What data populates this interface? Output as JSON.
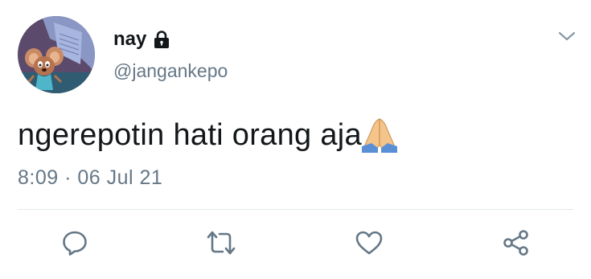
{
  "user": {
    "display_name": "nay",
    "handle": "@jangankepo",
    "protected_icon": "lock-icon"
  },
  "tweet": {
    "text": "ngerepotin hati orang aja",
    "emoji": "folded-hands-emoji",
    "timestamp": "8:09 · 06 Jul 21"
  },
  "menu_icon": "chevron-down-icon",
  "actions": [
    {
      "name": "reply",
      "icon": "reply-icon"
    },
    {
      "name": "retweet",
      "icon": "retweet-icon"
    },
    {
      "name": "like",
      "icon": "heart-icon"
    },
    {
      "name": "share",
      "icon": "share-icon"
    }
  ],
  "colors": {
    "text": "#14171a",
    "secondary": "#657786",
    "icon": "#657786",
    "divider": "#e1e8ed"
  }
}
